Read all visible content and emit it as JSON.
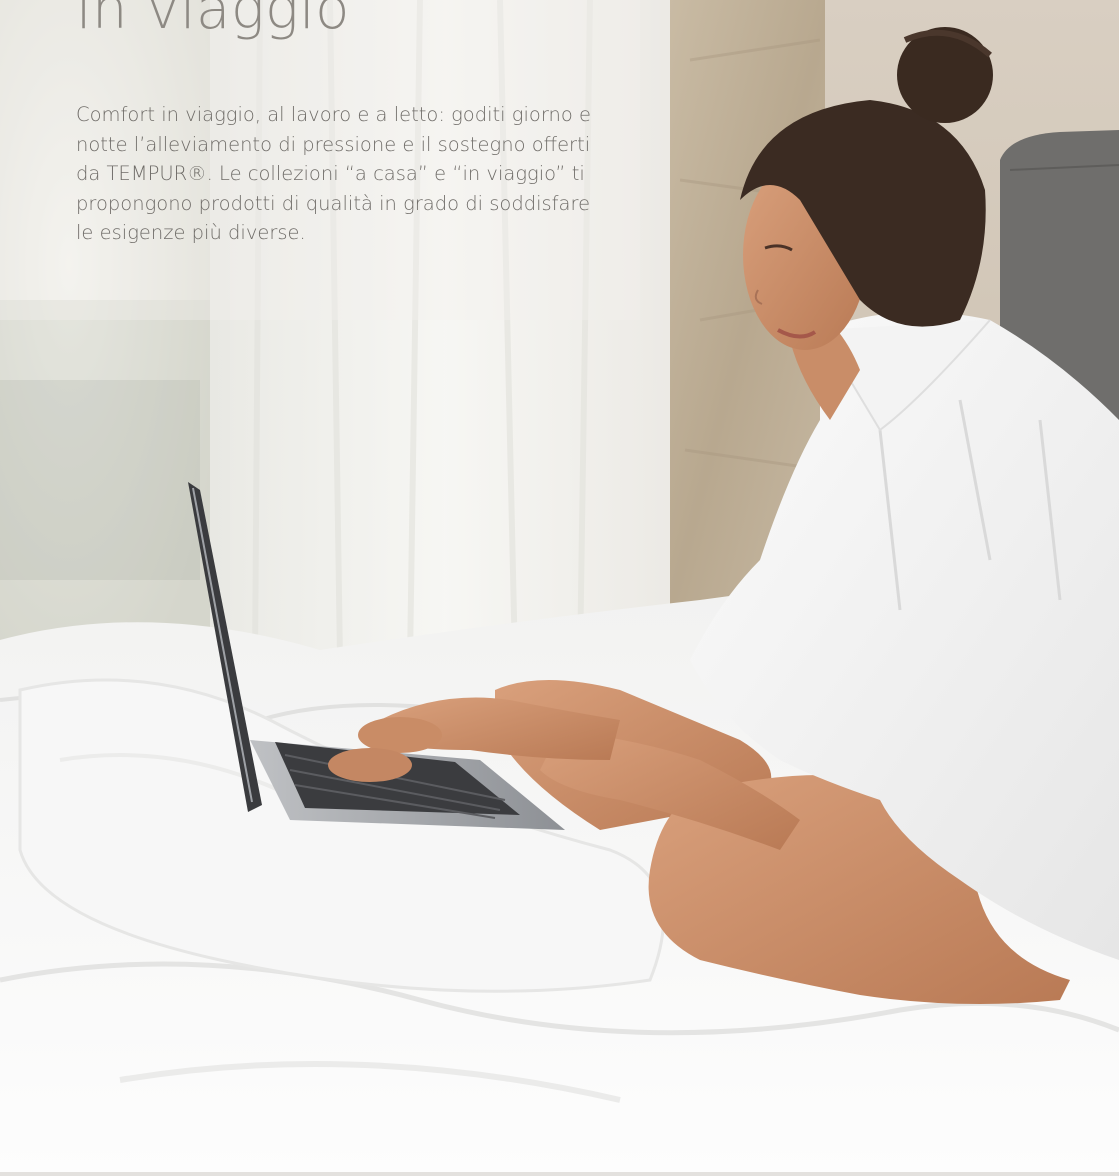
{
  "hero": {
    "headline": "in viaggio",
    "body": "Comfort in viaggio, al lavoro e a letto: goditi giorno e notte l’alleviamento di pressione e il sostegno offerti da TEMPUR®. Le collezioni “a casa” e “in viaggio” ti propongono prodotti di qualità in grado di soddisfare le esigenze più diverse.",
    "image_subject": "woman-typing-on-laptop-in-bed"
  },
  "colors": {
    "headline": "#8d8983",
    "body_text": "#6f6c68",
    "background": "#f4f2ef"
  }
}
